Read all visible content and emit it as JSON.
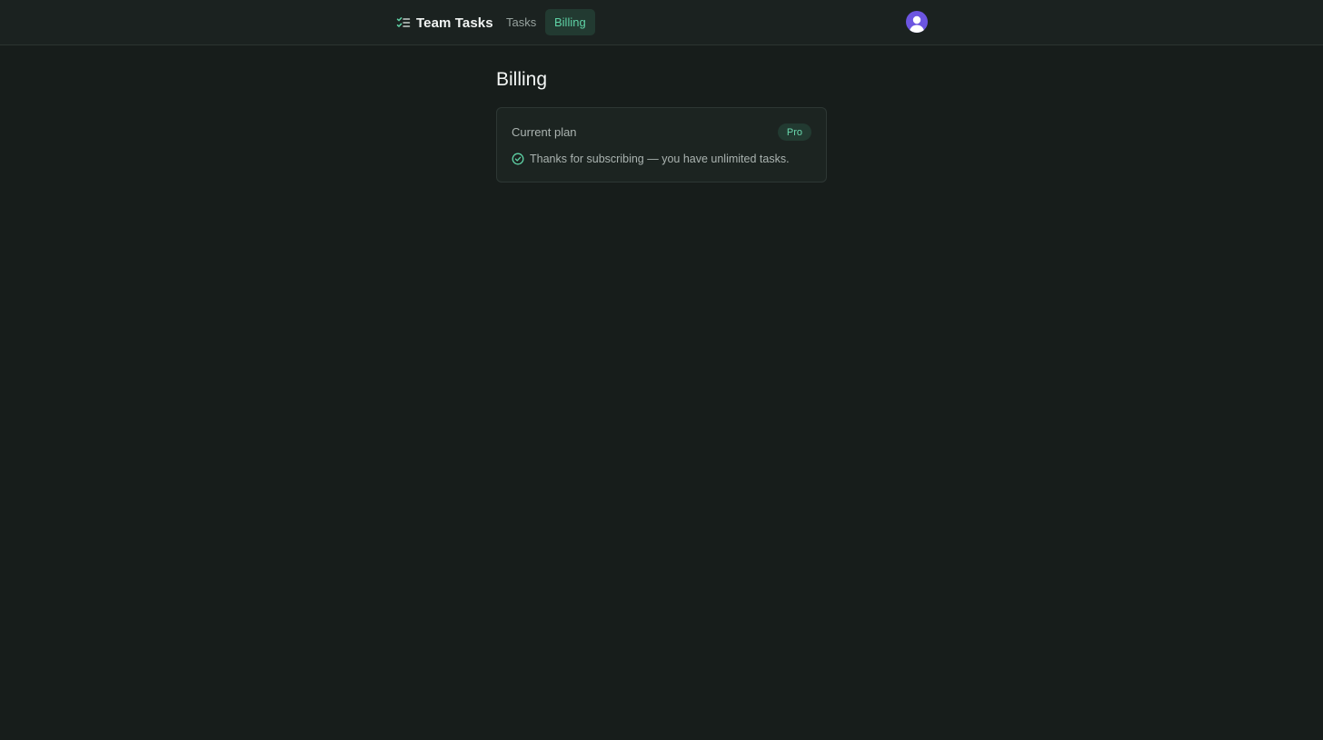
{
  "header": {
    "app_name": "Team Tasks",
    "logo_icon": "checklist-icon",
    "nav": [
      {
        "label": "Tasks",
        "active": false
      },
      {
        "label": "Billing",
        "active": true
      }
    ],
    "avatar_icon": "user-avatar-icon"
  },
  "main": {
    "page_title": "Billing",
    "plan_card": {
      "label": "Current plan",
      "plan_name": "Pro",
      "status_icon": "check-circle-icon",
      "message": "Thanks for subscribing — you have unlimited tasks."
    }
  },
  "colors": {
    "background": "#171d1b",
    "header_background": "#1b2220",
    "accent": "#5fd3a6",
    "accent_bg": "#223a31",
    "avatar": "#6c55e0"
  }
}
